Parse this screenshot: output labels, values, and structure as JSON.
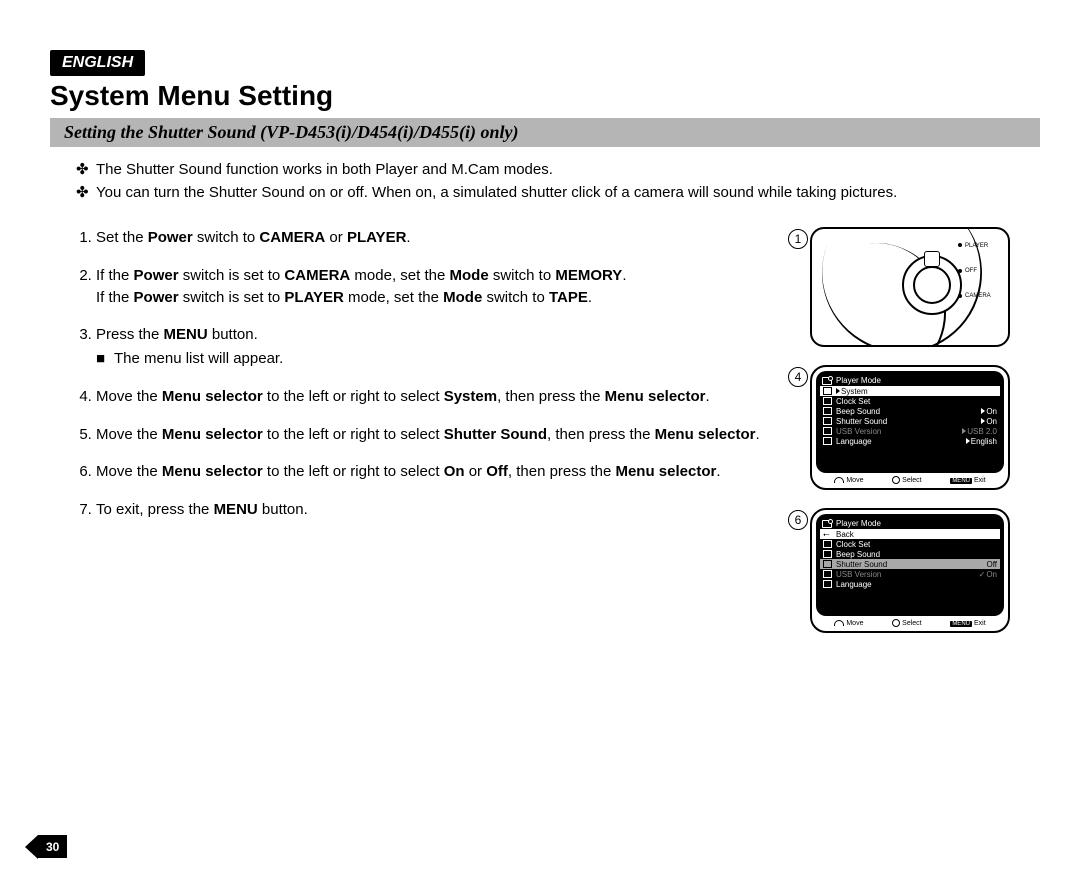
{
  "language_label": "ENGLISH",
  "title": "System Menu Setting",
  "subtitle": "Setting the Shutter Sound (VP-D453(i)/D454(i)/D455(i) only)",
  "intro_bullets": [
    "The Shutter Sound function works in both Player and M.Cam modes.",
    "You can turn the Shutter Sound on or off. When on, a simulated shutter click of a camera will sound while taking pictures."
  ],
  "steps": [
    {
      "html": "Set the <b>Power</b> switch to <b>CAMERA</b> or <b>PLAYER</b>."
    },
    {
      "html": "If the <b>Power</b> switch is set to <b>CAMERA</b> mode, set the <b>Mode</b> switch to <b>MEMORY</b>.<br>If the <b>Power</b> switch is set to <b>PLAYER</b> mode, set the <b>Mode</b> switch to <b>TAPE</b>."
    },
    {
      "html": "Press the <b>MENU</b> button.",
      "sub": "The menu list will appear."
    },
    {
      "html": "Move the <b>Menu selector</b> to the left or right to select <b>System</b>, then press the <b>Menu selector</b>."
    },
    {
      "html": "Move the <b>Menu selector</b> to the left or right to select <b>Shutter Sound</b>, then press the <b>Menu selector</b>."
    },
    {
      "html": "Move the <b>Menu selector</b> to the left or right to select <b>On</b> or <b>Off</b>, then press the <b>Menu selector</b>."
    },
    {
      "html": "To exit, press the <b>MENU</b> button."
    }
  ],
  "diagram1": {
    "switch_labels": [
      "PLAYER",
      "OFF",
      "CAMERA"
    ],
    "badge": "1"
  },
  "screen_a": {
    "badge": "4",
    "header": "Player Mode",
    "rows": [
      {
        "label": "System",
        "hl": true,
        "icon": true,
        "tri": true
      },
      {
        "label": "Clock Set",
        "icon": true
      },
      {
        "label": "Beep Sound",
        "val": "On",
        "icon": true,
        "tri": true
      },
      {
        "label": "Shutter Sound",
        "val": "On",
        "icon": true,
        "tri": true
      },
      {
        "label": "USB Version",
        "val": "USB 2.0",
        "dim": true,
        "icon": true,
        "tri": true
      },
      {
        "label": "Language",
        "val": "English",
        "icon": true,
        "tri": true
      }
    ],
    "hints": {
      "move": "Move",
      "select": "Select",
      "menu": "MENU",
      "exit": "Exit"
    }
  },
  "screen_b": {
    "badge": "6",
    "header": "Player Mode",
    "rows": [
      {
        "label": "Back",
        "hl": true,
        "back": true
      },
      {
        "label": "Clock Set",
        "icon": true
      },
      {
        "label": "Beep Sound",
        "icon": true
      },
      {
        "label": "Shutter Sound",
        "val": "Off",
        "sel": true,
        "icon": true
      },
      {
        "label": "USB Version",
        "val": "On",
        "dim": true,
        "icon": true,
        "chk": true
      },
      {
        "label": "Language",
        "icon": true
      }
    ],
    "hints": {
      "move": "Move",
      "select": "Select",
      "menu": "MENU",
      "exit": "Exit"
    }
  },
  "page_number": "30"
}
